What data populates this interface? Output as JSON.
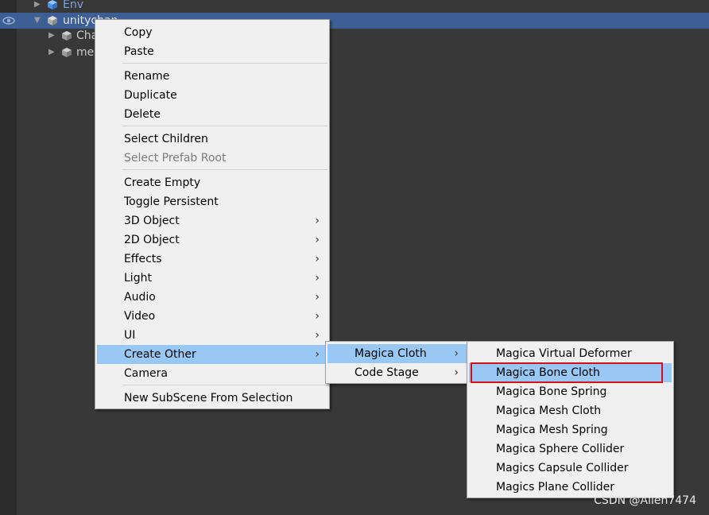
{
  "hierarchy": {
    "rows": [
      {
        "label": "Env"
      },
      {
        "label": "unitychan"
      },
      {
        "label": "Cha"
      },
      {
        "label": "mes"
      }
    ]
  },
  "context_menu": {
    "copy": "Copy",
    "paste": "Paste",
    "rename": "Rename",
    "duplicate": "Duplicate",
    "delete": "Delete",
    "select_children": "Select Children",
    "select_prefab_root": "Select Prefab Root",
    "create_empty": "Create Empty",
    "toggle_persistent": "Toggle Persistent",
    "object_3d": "3D Object",
    "object_2d": "2D Object",
    "effects": "Effects",
    "light": "Light",
    "audio": "Audio",
    "video": "Video",
    "ui": "UI",
    "create_other": "Create Other",
    "camera": "Camera",
    "new_subscene": "New SubScene From Selection",
    "submenu_arrow": "›"
  },
  "create_other_menu": {
    "magica_cloth": "Magica Cloth",
    "code_stage": "Code Stage"
  },
  "magica_cloth_menu": {
    "items": [
      "Magica Virtual Deformer",
      "Magica Bone Cloth",
      "Magica Bone Spring",
      "Magica Mesh Cloth",
      "Magica Mesh Spring",
      "Magica Sphere Collider",
      "Magics Capsule Collider",
      "Magics Plane Collider"
    ]
  },
  "watermark": "CSDN @Allen7474",
  "colors": {
    "selection": "#3e5f96",
    "menu_highlight": "#99c8f5",
    "annotation_red": "#d0121b"
  }
}
